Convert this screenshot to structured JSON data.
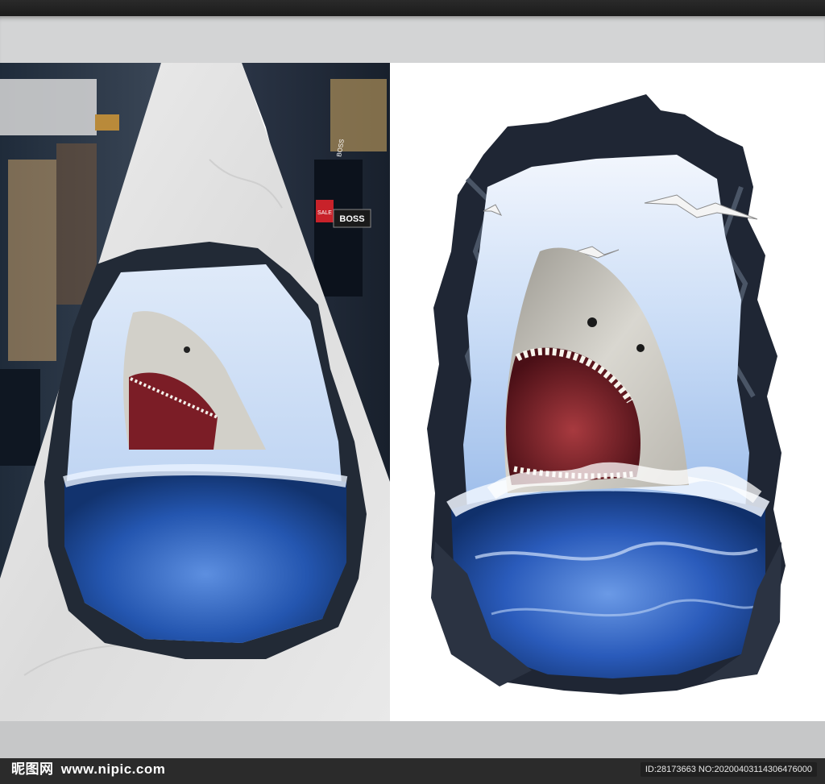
{
  "watermark": {
    "brand_cn": "昵图网",
    "url": "www.nipic.com",
    "image_id": "ID:28173663 NO:20200403114306476000"
  },
  "store_signs": {
    "sale": "SALE",
    "boss": "BOSS",
    "boss_small": "BOSS"
  },
  "icons": {
    "main_left": "shark-floor-decal-mockup",
    "main_right": "shark-decal-artwork"
  },
  "colors": {
    "ocean_deep": "#1d4fa6",
    "ocean_light": "#6fa6e8",
    "rock": "#2a3140",
    "shark_gray": "#cfcdc6",
    "mouth_red": "#7a1e26",
    "marble": "#e6e6e6",
    "frame_dark": "#1e1e1e"
  }
}
